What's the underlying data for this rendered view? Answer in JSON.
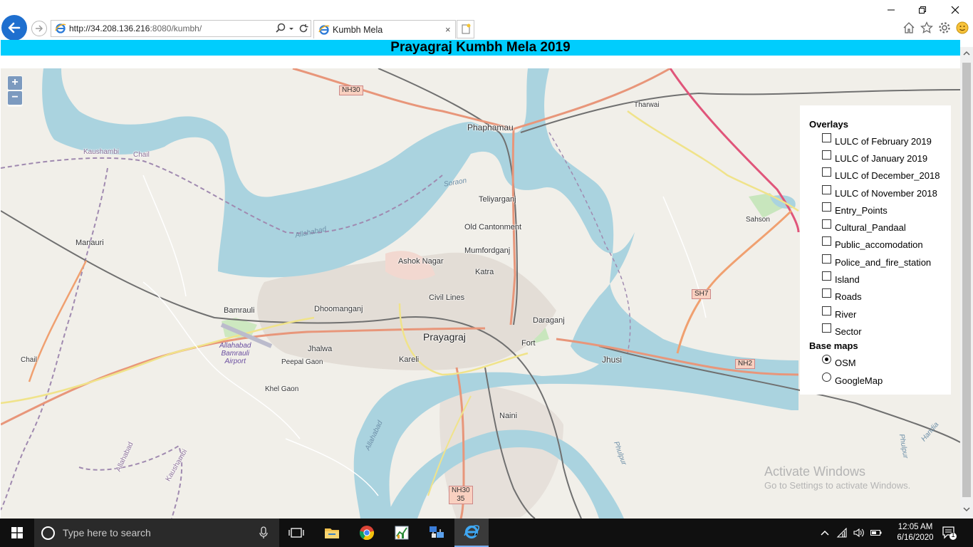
{
  "browser": {
    "url_main": "http://34.208.136.216",
    "url_rest": ":8080/kumbh/",
    "tab_title": "Kumbh Mela",
    "tab_close": "×"
  },
  "page": {
    "title": "Prayagraj Kumbh Mela 2019"
  },
  "map": {
    "zoom_in": "+",
    "zoom_out": "−",
    "places": {
      "phaphamau": "Phaphamau",
      "tharwai": "Tharwai",
      "kaushambi": "Kaushambi",
      "chail_top": "Chail",
      "teliyarganj": "Teliyarganj",
      "old_cantonment": "Old Cantonment",
      "mumfordganj": "Mumfordganj",
      "manauri": "Manauri",
      "ashok_nagar": "Ashok Nagar",
      "katra": "Katra",
      "sahson": "Sahson",
      "civil_lines": "Civil Lines",
      "bamrauli": "Bamrauli",
      "dhoomanganj": "Dhoomanganj",
      "daraganj": "Daraganj",
      "prayagraj": "Prayagraj",
      "fort": "Fort",
      "jhalwa": "Jhalwa",
      "jhusi": "Jhusi",
      "chail_left": "Chail",
      "peepal_gaon": "Peepal Gaon",
      "kareli": "Kareli",
      "khel_gaon": "Khel Gaon",
      "naini": "Naini",
      "allahabad_left": "Allahabad",
      "kaushambi_left": "Kaushambi"
    },
    "roads": {
      "nh30_top": "NH30",
      "sh7": "SH7",
      "nh2": "NH2",
      "nh30_35_a": "NH30",
      "nh30_35_b": "35"
    },
    "water_labels": {
      "soraon": "Soraon",
      "allahabad_river": "Allahabad",
      "allahabad_south": "Allahabad",
      "phulpur": "Phulpur",
      "phulpur_right": "Phulpur",
      "handia": "Handia"
    },
    "airport": {
      "line1": "Allahabad",
      "line2": "Bamrauli",
      "line3": "Airport"
    }
  },
  "layer_switcher": {
    "overlays_heading": "Overlays",
    "overlays": [
      {
        "label": "LULC of February 2019",
        "checked": false
      },
      {
        "label": "LULC of January 2019",
        "checked": false
      },
      {
        "label": "LULC of December_2018",
        "checked": false
      },
      {
        "label": "LULC of November 2018",
        "checked": false
      },
      {
        "label": "Entry_Points",
        "checked": false
      },
      {
        "label": "Cultural_Pandaal",
        "checked": false
      },
      {
        "label": "Public_accomodation",
        "checked": false
      },
      {
        "label": "Police_and_fire_station",
        "checked": false
      },
      {
        "label": "Island",
        "checked": false
      },
      {
        "label": "Roads",
        "checked": false
      },
      {
        "label": "River",
        "checked": false
      },
      {
        "label": "Sector",
        "checked": false
      }
    ],
    "basemaps_heading": "Base maps",
    "basemaps": [
      {
        "label": "OSM",
        "checked": true
      },
      {
        "label": "GoogleMap",
        "checked": false
      }
    ]
  },
  "watermark": {
    "title": "Activate Windows",
    "subtitle": "Go to Settings to activate Windows."
  },
  "taskbar": {
    "search_placeholder": "Type here to search",
    "time": "12:05 AM",
    "date": "6/16/2020",
    "notification_count": "1"
  },
  "colors": {
    "header_bg": "#00cdfd",
    "water": "#aad3df",
    "land": "#f1efe9",
    "primary_road": "#e8967a",
    "secondary_road": "#f0e38a"
  }
}
